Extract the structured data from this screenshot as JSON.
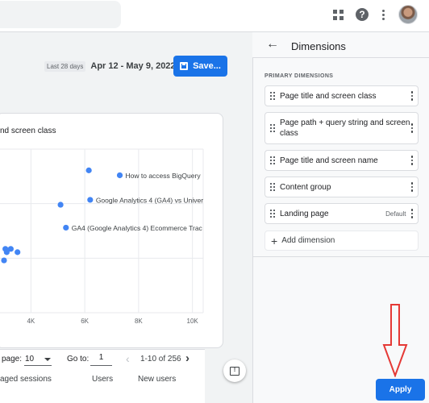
{
  "header": {
    "icons": [
      "apps-grid-icon",
      "help-icon",
      "more-vert-icon",
      "avatar"
    ]
  },
  "toolbar": {
    "date_caption": "Last 28 days",
    "date_range": "Apr 12 - May 9, 2022",
    "save_label": "Save..."
  },
  "card": {
    "title": "nd screen class"
  },
  "chart_data": {
    "type": "scatter",
    "title": "nd screen class",
    "x_ticks": [
      "4K",
      "6K",
      "8K",
      "10K"
    ],
    "xlim": [
      2850,
      10400
    ],
    "grid": true,
    "points": [
      {
        "x": 6150,
        "y": 0.87,
        "label": ""
      },
      {
        "x": 7300,
        "y": 0.84,
        "label": "How to access BigQuery"
      },
      {
        "x": 5100,
        "y": 0.66,
        "label": ""
      },
      {
        "x": 6200,
        "y": 0.69,
        "label": "Google Analytics 4 (GA4) vs Univer"
      },
      {
        "x": 5300,
        "y": 0.52,
        "label": "GA4 (Google Analytics 4) Ecommerce Trac"
      },
      {
        "x": 3050,
        "y": 0.39,
        "label": ""
      },
      {
        "x": 3250,
        "y": 0.39,
        "label": ""
      },
      {
        "x": 3100,
        "y": 0.37,
        "label": ""
      },
      {
        "x": 3500,
        "y": 0.37,
        "label": ""
      },
      {
        "x": 3000,
        "y": 0.32,
        "label": ""
      }
    ]
  },
  "table": {
    "rows_per_page_label": "page:",
    "rows_per_page_value": "10",
    "goto_label": "Go to:",
    "goto_value": "1",
    "range": "1-10 of 256",
    "columns": [
      "aged sessions",
      "Users",
      "New users"
    ]
  },
  "panel": {
    "title": "Dimensions",
    "section_label": "PRIMARY DIMENSIONS",
    "items": [
      {
        "label": "Page title and screen class",
        "default": ""
      },
      {
        "label": "Page path + query string and screen class",
        "default": ""
      },
      {
        "label": "Page title and screen name",
        "default": ""
      },
      {
        "label": "Content group",
        "default": ""
      },
      {
        "label": "Landing page",
        "default": "Default"
      }
    ],
    "add_label": "Add dimension",
    "apply_label": "Apply"
  },
  "colors": {
    "accent": "#1a73e8",
    "point": "#4285f4",
    "annotation_arrow": "#e53935"
  }
}
